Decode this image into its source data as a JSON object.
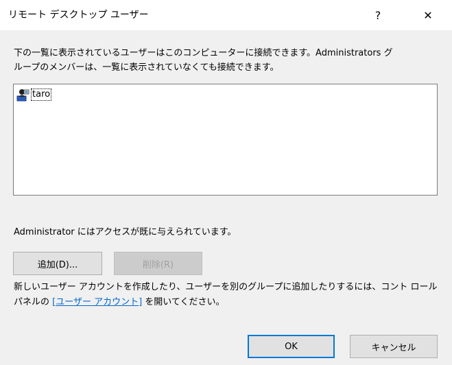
{
  "window": {
    "title": "リモート デスクトップ ユーザー",
    "help_glyph": "?",
    "close_glyph": "✕"
  },
  "description": "下の一覧に表示されているユーザーはこのコンピューターに接続できます。Administrators グ\nループのメンバーは、一覧に表示されていなくても接続できます。",
  "user_list": {
    "items": [
      {
        "label": "taro",
        "icon": "user-icon"
      }
    ]
  },
  "access_text": "Administrator にはアクセスが既に与えられています。",
  "buttons": {
    "add_label": "追加(D)...",
    "remove_label": "削除(R)",
    "ok_label": "OK",
    "cancel_label": "キャンセル"
  },
  "info": {
    "text_before": "新しいユーザー アカウントを作成したり、ユーザーを別のグループに追加したりするには、コント ロール パネルの ",
    "link_label": "[ユーザー アカウント]",
    "text_after": " を開いてください。"
  },
  "colors": {
    "accent": "#0078d7",
    "link": "#0066cc",
    "background": "#f0f0f0"
  }
}
